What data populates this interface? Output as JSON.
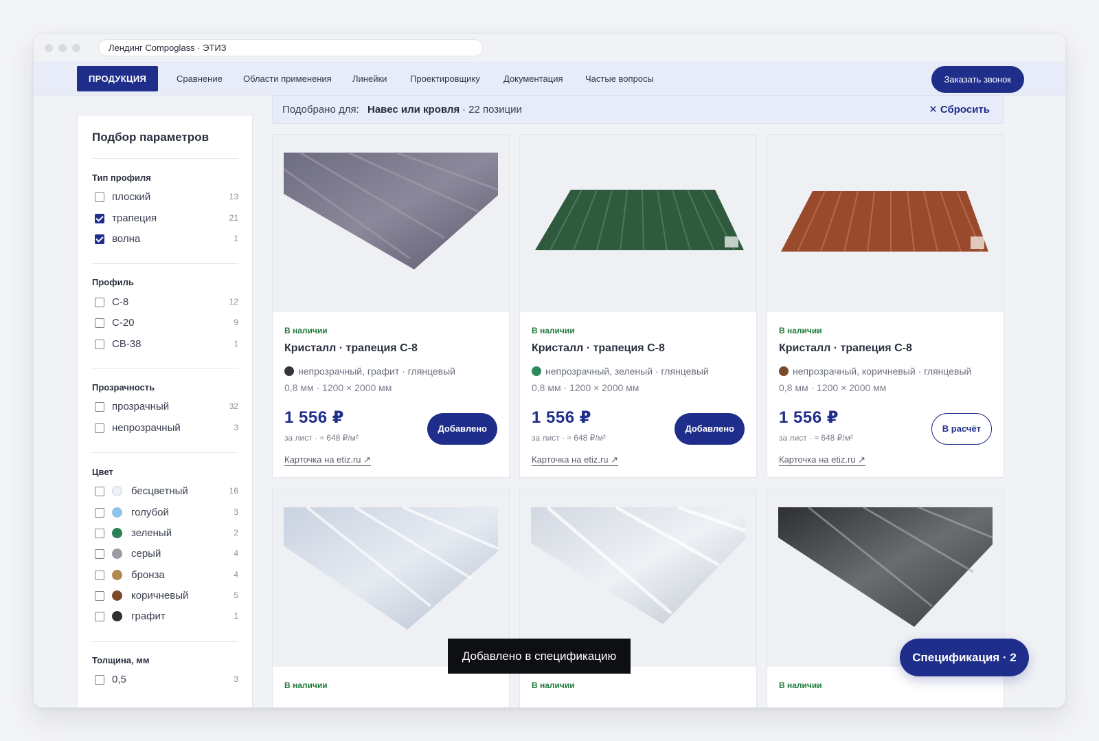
{
  "window": {
    "address": "Лендинг Compoglass · ЭТИЗ"
  },
  "nav": {
    "brand": "ПРОДУКЦИЯ",
    "links": [
      "Сравнение",
      "Области применения",
      "Линейки",
      "Проектировщику",
      "Документация",
      "Частые вопросы"
    ],
    "cta": "Заказать звонок"
  },
  "filter_bar": {
    "prefix": "Подобрано для:",
    "value": "Навес или кровля",
    "count": "· 22 позиции",
    "reset": "Сбросить"
  },
  "sidebar": {
    "title": "Подбор параметров",
    "groups": [
      {
        "title": "Тип профиля",
        "items": [
          {
            "label": "плоский",
            "count": "13",
            "checked": false
          },
          {
            "label": "трапеция",
            "count": "21",
            "checked": true
          },
          {
            "label": "волна",
            "count": "1",
            "checked": true
          }
        ]
      },
      {
        "title": "Профиль",
        "items": [
          {
            "label": "С-8",
            "count": "12",
            "checked": false
          },
          {
            "label": "С-20",
            "count": "9",
            "checked": false
          },
          {
            "label": "СВ-38",
            "count": "1",
            "checked": false
          }
        ]
      },
      {
        "title": "Прозрачность",
        "items": [
          {
            "label": "прозрачный",
            "count": "32",
            "checked": false
          },
          {
            "label": "непрозрачный",
            "count": "3",
            "checked": false
          }
        ]
      },
      {
        "title": "Цвет",
        "items": [
          {
            "label": "бесцветный",
            "count": "16",
            "checked": false,
            "swatch": "#eef1f7"
          },
          {
            "label": "голубой",
            "count": "3",
            "checked": false,
            "swatch": "#8fc4ea"
          },
          {
            "label": "зеленый",
            "count": "2",
            "checked": false,
            "swatch": "#2a7f55"
          },
          {
            "label": "серый",
            "count": "4",
            "checked": false,
            "swatch": "#9a9ca3"
          },
          {
            "label": "бронза",
            "count": "4",
            "checked": false,
            "swatch": "#b08a4f"
          },
          {
            "label": "коричневый",
            "count": "5",
            "checked": false,
            "swatch": "#7a4a2a"
          },
          {
            "label": "графит",
            "count": "1",
            "checked": false,
            "swatch": "#2f3033"
          }
        ]
      },
      {
        "title": "Толщина, мм",
        "items": [
          {
            "label": "0,5",
            "count": "3",
            "checked": false
          }
        ]
      }
    ]
  },
  "products": [
    {
      "stock": "В наличии",
      "title": "Кристалл · трапеция С-8",
      "dot": "#35363a",
      "spec": "непрозрачный, графит · глянцевый",
      "dims": "0,8 мм · 1200 × 2000 мм",
      "price": "1 556 ₽",
      "price_sub": "за лист · ≈ 648 ₽/м²",
      "link": "Карточка на etiz.ru ↗",
      "button": "Добавлено",
      "state": "added"
    },
    {
      "stock": "В наличии",
      "title": "Кристалл · трапеция С-8",
      "dot": "#2a8a5c",
      "spec": "непрозрачный, зеленый · глянцевый",
      "dims": "0,8 мм · 1200 × 2000 мм",
      "price": "1 556 ₽",
      "price_sub": "за лист · ≈ 648 ₽/м²",
      "link": "Карточка на etiz.ru ↗",
      "button": "Добавлено",
      "state": "added"
    },
    {
      "stock": "В наличии",
      "title": "Кристалл · трапеция С-8",
      "dot": "#7a4a2a",
      "spec": "непрозрачный, коричневый · глянцевый",
      "dims": "0,8 мм · 1200 × 2000 мм",
      "price": "1 556 ₽",
      "price_sub": "за лист · ≈ 648 ₽/м²",
      "link": "Карточка на etiz.ru ↗",
      "button": "В расчёт",
      "state": "calc"
    },
    {
      "stock": "В наличии"
    },
    {
      "stock": "В наличии"
    },
    {
      "stock": "В наличии"
    }
  ],
  "colors": {
    "accent": "#1f2e8a",
    "in_stock": "#1f7a3a"
  },
  "toast": "Добавлено в спецификацию",
  "spec_button": "Спецификация · 2"
}
